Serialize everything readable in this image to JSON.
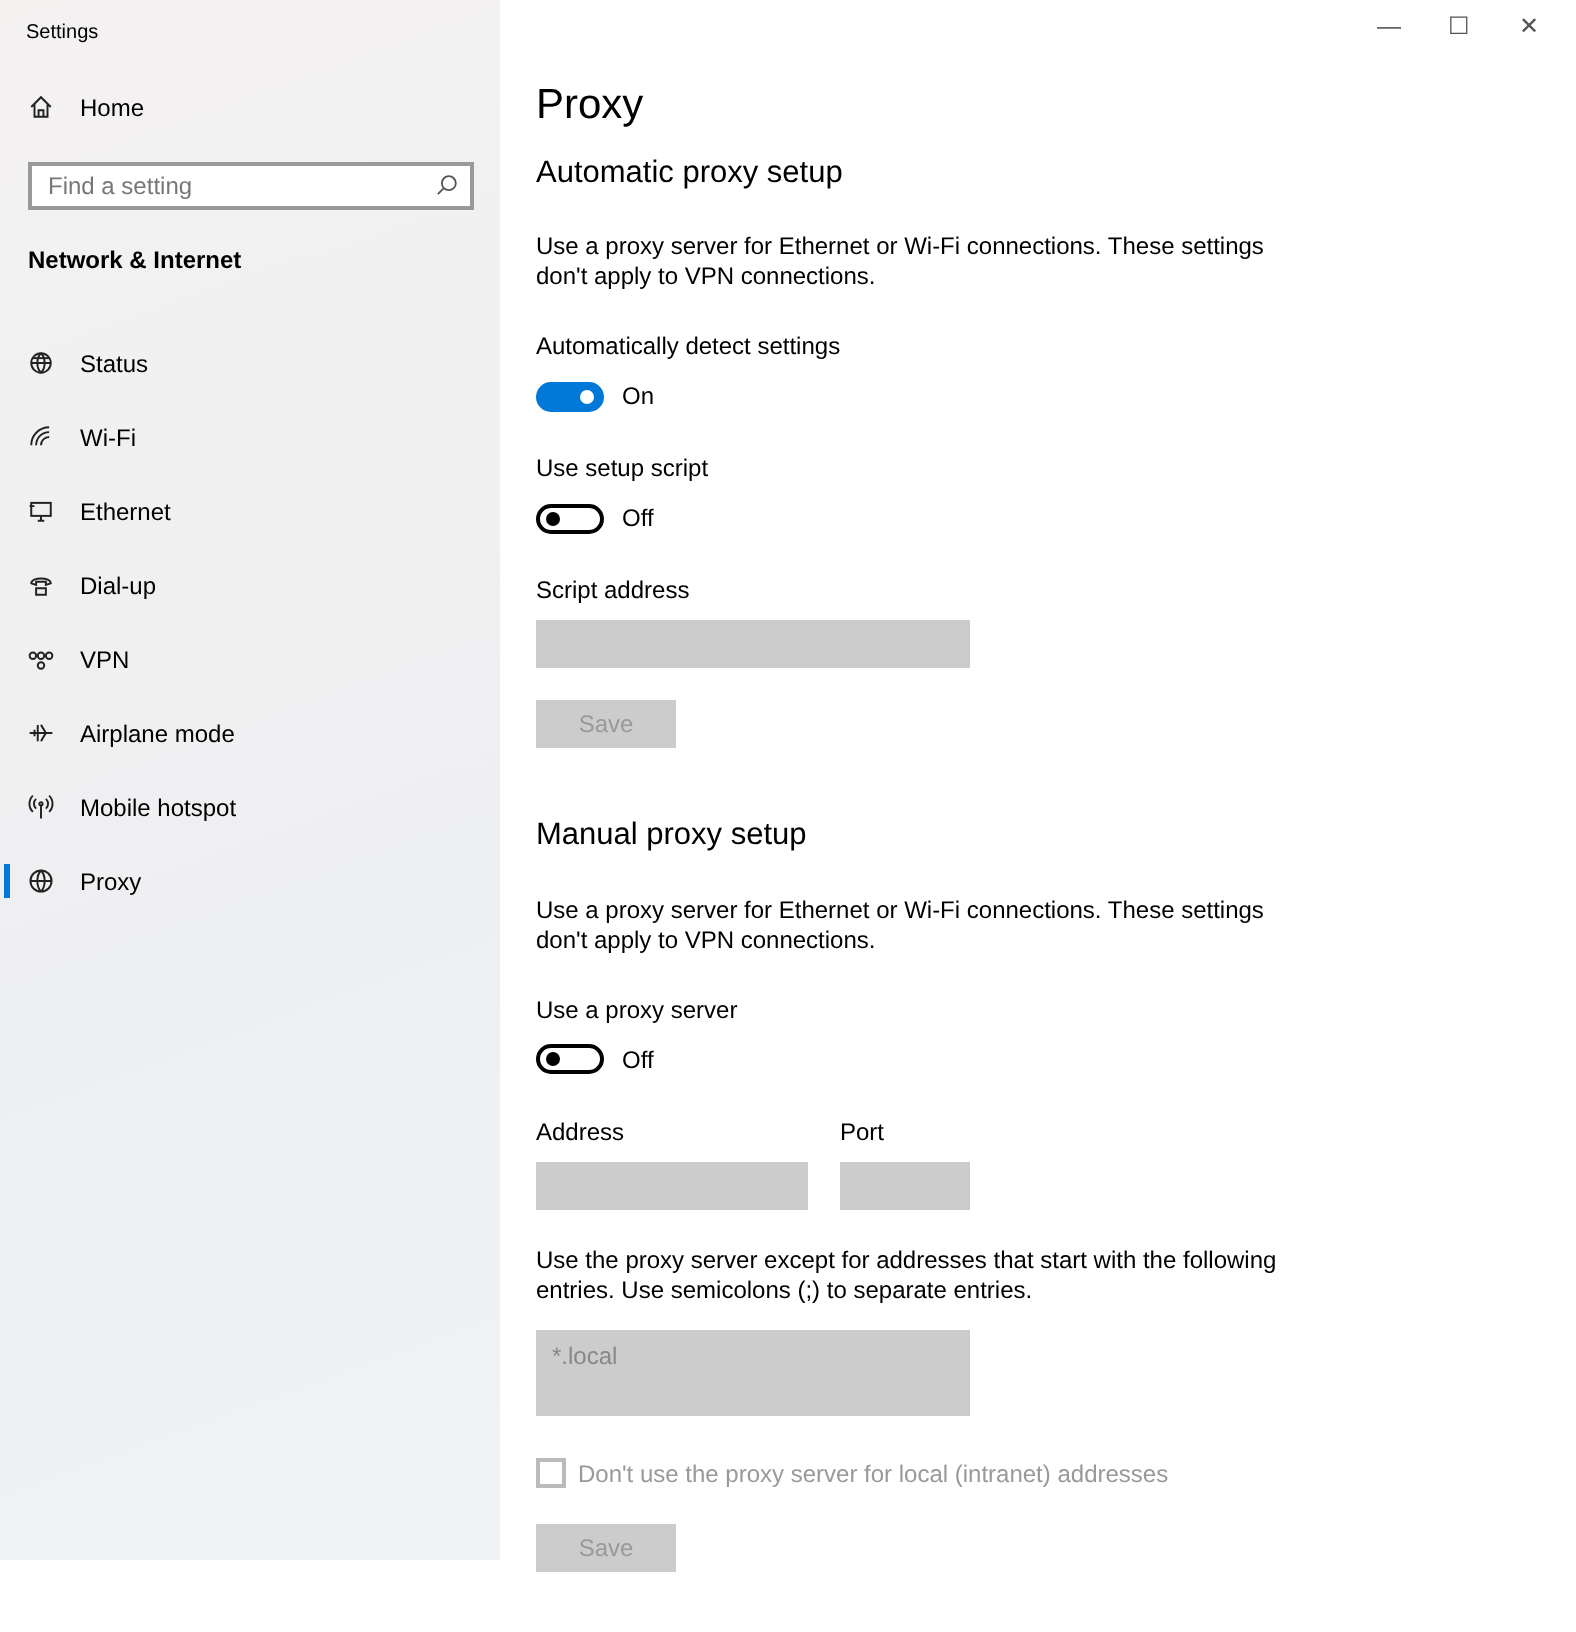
{
  "window": {
    "title": "Settings",
    "controls": [
      "—",
      "☐",
      "✕"
    ]
  },
  "sidebar": {
    "home": "Home",
    "search": {
      "placeholder": "Find a setting"
    },
    "group": "Network & Internet",
    "items": [
      {
        "label": "Status",
        "selected": false
      },
      {
        "label": "Wi-Fi",
        "selected": false
      },
      {
        "label": "Ethernet",
        "selected": false
      },
      {
        "label": "Dial-up",
        "selected": false
      },
      {
        "label": "VPN",
        "selected": false
      },
      {
        "label": "Airplane mode",
        "selected": false
      },
      {
        "label": "Mobile hotspot",
        "selected": false
      },
      {
        "label": "Proxy",
        "selected": true
      }
    ]
  },
  "page": {
    "title": "Proxy",
    "sections": [
      {
        "heading": "Automatic proxy setup",
        "items": [
          {
            "kind": "text",
            "text": "Use a proxy server for Ethernet or Wi-Fi connections. These settings don't apply to VPN connections."
          },
          {
            "kind": "toggle",
            "label": "Automatically detect settings",
            "on": true,
            "state": "On"
          },
          {
            "kind": "toggle",
            "label": "Use setup script",
            "on": false,
            "state": "Off"
          },
          {
            "kind": "field",
            "label": "Script address",
            "disabled": true
          },
          {
            "kind": "button",
            "label": "Save",
            "disabled": true
          }
        ]
      },
      {
        "heading": "Manual proxy setup",
        "items": [
          {
            "kind": "text",
            "text": "Use a proxy server for Ethernet or Wi-Fi connections. These settings don't apply to VPN connections."
          },
          {
            "kind": "toggle",
            "label": "Use a proxy server",
            "on": false,
            "state": "Off"
          },
          {
            "kind": "fieldpair",
            "fields": [
              {
                "label": "Address",
                "disabled": true
              },
              {
                "label": "Port",
                "disabled": true
              }
            ]
          },
          {
            "kind": "text",
            "text": "Use the proxy server except for addresses that start with the following entries. Use semicolons (;) to separate entries."
          },
          {
            "kind": "textarea",
            "value": "*.local",
            "disabled": true
          },
          {
            "kind": "checkbox",
            "label": "Don't use the proxy server for local (intranet) addresses",
            "checked": false,
            "disabled": true
          },
          {
            "kind": "button",
            "label": "Save",
            "disabled": true
          }
        ]
      }
    ]
  }
}
